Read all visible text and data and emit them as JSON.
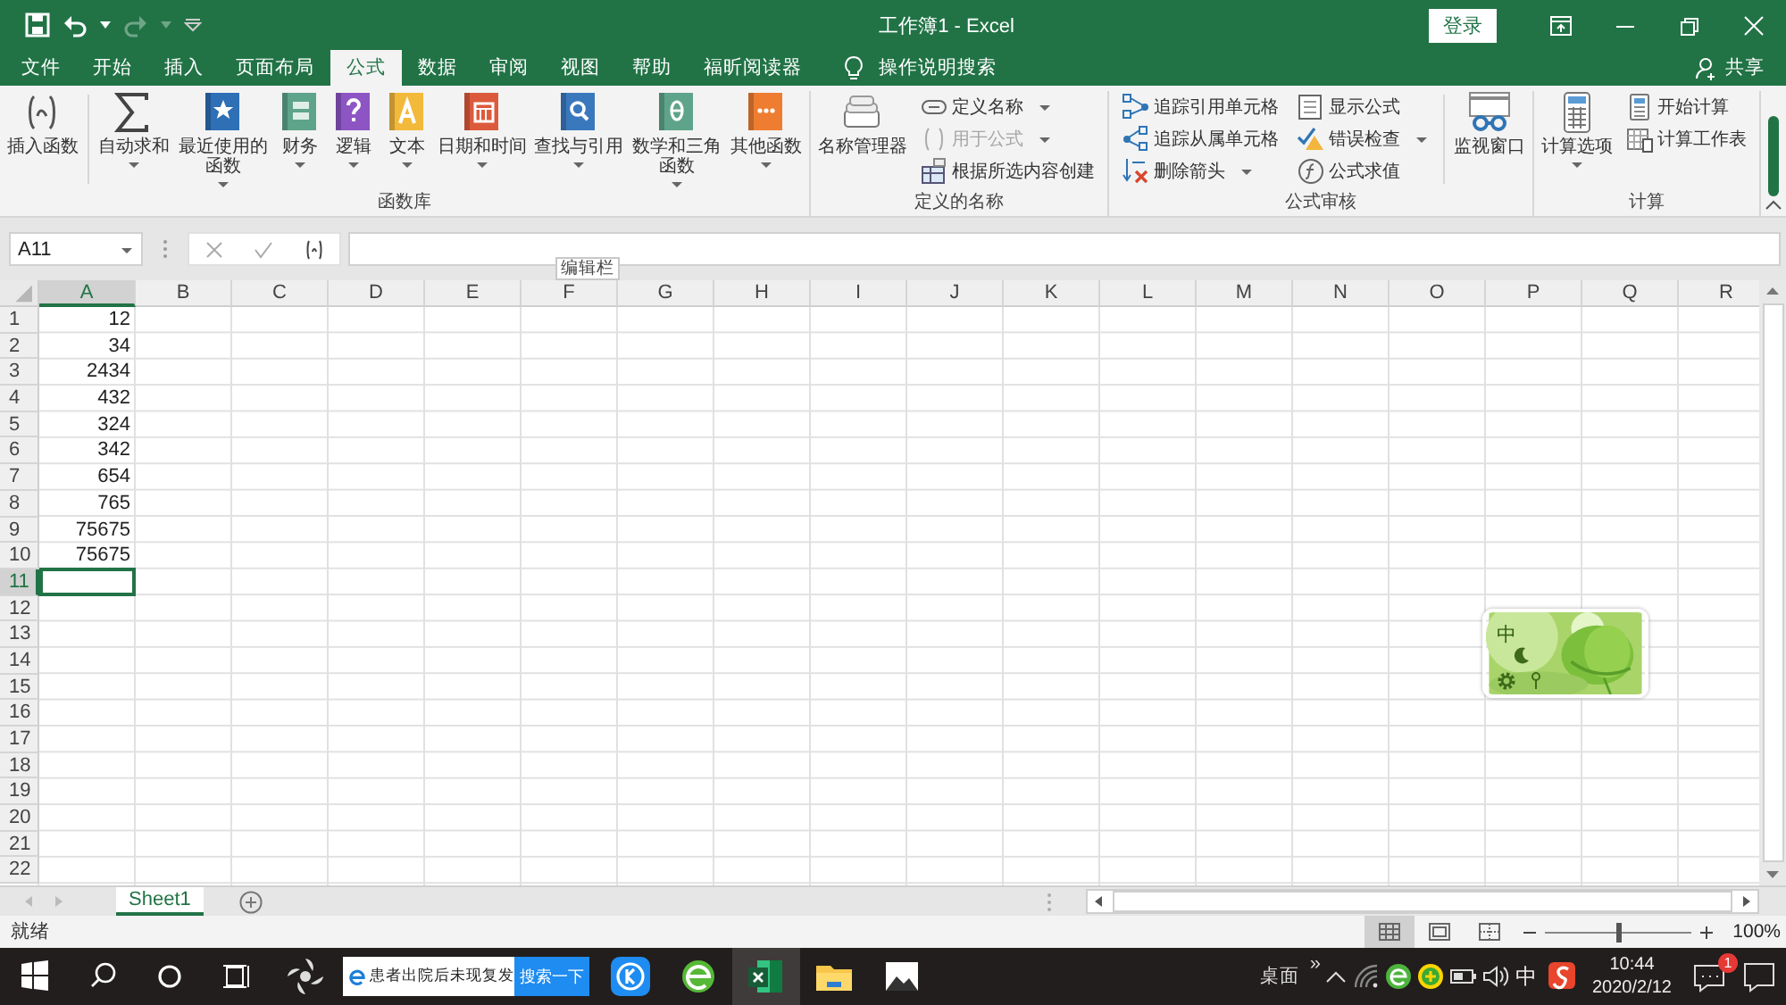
{
  "window": {
    "title": "工作簿1 - Excel",
    "login": "登录"
  },
  "tabs": [
    {
      "label": "文件",
      "selected": false
    },
    {
      "label": "开始",
      "selected": false
    },
    {
      "label": "插入",
      "selected": false
    },
    {
      "label": "页面布局",
      "selected": false
    },
    {
      "label": "公式",
      "selected": true
    },
    {
      "label": "数据",
      "selected": false
    },
    {
      "label": "审阅",
      "selected": false
    },
    {
      "label": "视图",
      "selected": false
    },
    {
      "label": "帮助",
      "selected": false
    },
    {
      "label": "福昕阅读器",
      "selected": false
    }
  ],
  "tell_me": "操作说明搜索",
  "share": "共享",
  "ribbon": {
    "groups": [
      {
        "label": "函数库",
        "items": [
          {
            "kind": "large",
            "label": "插入函数",
            "dropdown": false
          },
          {
            "kind": "separator"
          },
          {
            "kind": "large",
            "label": "自动求和",
            "dropdown": true
          },
          {
            "kind": "large",
            "label": "最近使用的函数",
            "dropdown": true
          },
          {
            "kind": "large",
            "label": "财务",
            "dropdown": true
          },
          {
            "kind": "large",
            "label": "逻辑",
            "dropdown": true
          },
          {
            "kind": "large",
            "label": "文本",
            "dropdown": true
          },
          {
            "kind": "large",
            "label": "日期和时间",
            "dropdown": true
          },
          {
            "kind": "large",
            "label": "查找与引用",
            "dropdown": true
          },
          {
            "kind": "large",
            "label": "数学和三角函数",
            "dropdown": true
          },
          {
            "kind": "large",
            "label": "其他函数",
            "dropdown": true
          }
        ]
      },
      {
        "label": "定义的名称",
        "items": [
          {
            "kind": "large",
            "label": "名称管理器",
            "dropdown": false
          },
          {
            "kind": "stack",
            "items": [
              {
                "label": "定义名称",
                "dropdown": true,
                "disabled": false
              },
              {
                "label": "用于公式",
                "dropdown": true,
                "disabled": true
              },
              {
                "label": "根据所选内容创建",
                "dropdown": false,
                "disabled": false
              }
            ]
          }
        ]
      },
      {
        "label": "公式审核",
        "items": [
          {
            "kind": "stack",
            "items": [
              {
                "label": "追踪引用单元格",
                "dropdown": false,
                "disabled": false
              },
              {
                "label": "追踪从属单元格",
                "dropdown": false,
                "disabled": false
              },
              {
                "label": "删除箭头",
                "dropdown": true,
                "disabled": false
              }
            ]
          },
          {
            "kind": "stack",
            "items": [
              {
                "label": "显示公式",
                "dropdown": false,
                "disabled": false
              },
              {
                "label": "错误检查",
                "dropdown": true,
                "disabled": false
              },
              {
                "label": "公式求值",
                "dropdown": false,
                "disabled": false
              }
            ]
          },
          {
            "kind": "separator"
          },
          {
            "kind": "large",
            "label": "监视窗口",
            "dropdown": false
          }
        ]
      },
      {
        "label": "计算",
        "items": [
          {
            "kind": "large",
            "label": "计算选项",
            "dropdown": true
          },
          {
            "kind": "stack",
            "items": [
              {
                "label": "开始计算",
                "dropdown": false,
                "disabled": false
              },
              {
                "label": "计算工作表",
                "dropdown": false,
                "disabled": false
              }
            ]
          }
        ]
      }
    ]
  },
  "formula_bar": {
    "name_box": "A11",
    "tooltip": "编辑栏"
  },
  "columns": [
    {
      "label": "A",
      "selected": true
    },
    {
      "label": "B",
      "selected": false
    },
    {
      "label": "C",
      "selected": false
    },
    {
      "label": "D",
      "selected": false
    },
    {
      "label": "E",
      "selected": false
    },
    {
      "label": "F",
      "selected": false
    },
    {
      "label": "G",
      "selected": false
    },
    {
      "label": "H",
      "selected": false
    },
    {
      "label": "I",
      "selected": false
    },
    {
      "label": "J",
      "selected": false
    },
    {
      "label": "K",
      "selected": false
    },
    {
      "label": "L",
      "selected": false
    },
    {
      "label": "M",
      "selected": false
    },
    {
      "label": "N",
      "selected": false
    },
    {
      "label": "O",
      "selected": false
    },
    {
      "label": "P",
      "selected": false
    },
    {
      "label": "Q",
      "selected": false
    },
    {
      "label": "R",
      "selected": false
    }
  ],
  "rows": [
    {
      "label": "1",
      "value": "12",
      "selected": false
    },
    {
      "label": "2",
      "value": "34",
      "selected": false
    },
    {
      "label": "3",
      "value": "2434",
      "selected": false
    },
    {
      "label": "4",
      "value": "432",
      "selected": false
    },
    {
      "label": "5",
      "value": "324",
      "selected": false
    },
    {
      "label": "6",
      "value": "342",
      "selected": false
    },
    {
      "label": "7",
      "value": "654",
      "selected": false
    },
    {
      "label": "8",
      "value": "765",
      "selected": false
    },
    {
      "label": "9",
      "value": "75675",
      "selected": false
    },
    {
      "label": "10",
      "value": "75675",
      "selected": false
    },
    {
      "label": "11",
      "selected": true
    },
    {
      "label": "12",
      "selected": false
    },
    {
      "label": "13",
      "selected": false
    },
    {
      "label": "14",
      "selected": false
    },
    {
      "label": "15",
      "selected": false
    },
    {
      "label": "16",
      "selected": false
    },
    {
      "label": "17",
      "selected": false
    },
    {
      "label": "18",
      "selected": false
    },
    {
      "label": "19",
      "selected": false
    },
    {
      "label": "20",
      "selected": false
    },
    {
      "label": "21",
      "selected": false
    },
    {
      "label": "22",
      "selected": false
    }
  ],
  "sheets": [
    {
      "label": "Sheet1",
      "selected": true
    }
  ],
  "status_bar": {
    "text": "就绪",
    "views": [
      {
        "selected": true
      },
      {
        "selected": false
      },
      {
        "selected": false
      }
    ],
    "zoom": {
      "level": 0.5,
      "label": "100%"
    }
  },
  "ime_widget": {
    "label": "中"
  },
  "taskbar": {
    "apps": [
      {
        "selected": false
      },
      {
        "selected": false
      },
      {
        "selected": false
      },
      {
        "selected": true
      },
      {
        "selected": false
      },
      {
        "selected": false
      }
    ],
    "search_text": "患者出院后未现复发",
    "search_button": "搜索一下",
    "desktop": "桌面",
    "overflow": "»",
    "ime": "中",
    "time": "10:44",
    "date": "2020/2/12",
    "notifications": "1"
  }
}
